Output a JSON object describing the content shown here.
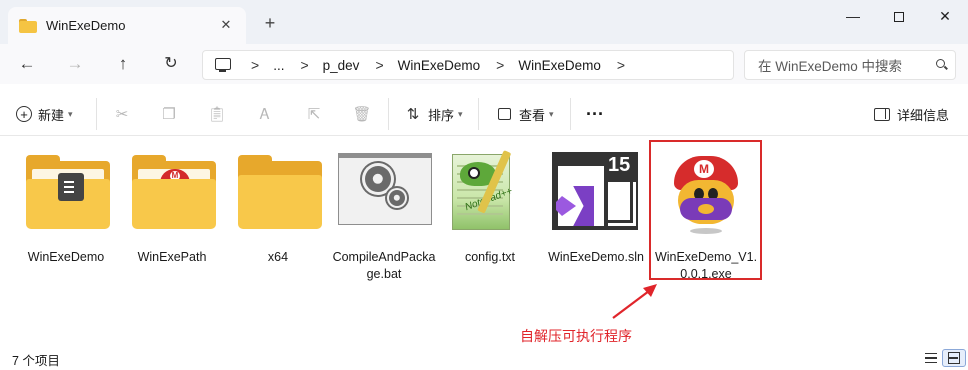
{
  "window": {
    "tab_title": "WinExeDemo",
    "close_tab": "✕",
    "new_tab": "+",
    "minimize": "—",
    "close": "✕"
  },
  "nav": {
    "back": "←",
    "forward": "→",
    "up": "↑",
    "refresh": "↻",
    "breadcrumbs": [
      "...",
      "p_dev",
      "WinExeDemo",
      "WinExeDemo"
    ],
    "separator": ">",
    "search_placeholder": "在 WinExeDemo 中搜索"
  },
  "toolbar": {
    "new_label": "新建",
    "sort_label": "排序",
    "view_label": "查看",
    "more": "···",
    "details_label": "详细信息"
  },
  "files": [
    {
      "name": "WinExeDemo",
      "type": "folder-doc"
    },
    {
      "name": "WinExePath",
      "type": "folder-mario"
    },
    {
      "name": "x64",
      "type": "folder"
    },
    {
      "name": "CompileAndPackage.bat",
      "type": "bat"
    },
    {
      "name": "config.txt",
      "type": "notepad"
    },
    {
      "name": "WinExeDemo.sln",
      "type": "sln"
    },
    {
      "name": "WinExeDemo_V1.0.0.1.exe",
      "type": "exe",
      "selected": true
    }
  ],
  "sln_badge": "15",
  "mario_letter": "M",
  "npp_text": "Notepad++",
  "annotation": "自解压可执行程序",
  "status": {
    "item_count": "7 个项目"
  },
  "colors": {
    "accent_red": "#d92a2a",
    "folder": "#f8c84a",
    "vs_purple": "#7b3fc4"
  }
}
